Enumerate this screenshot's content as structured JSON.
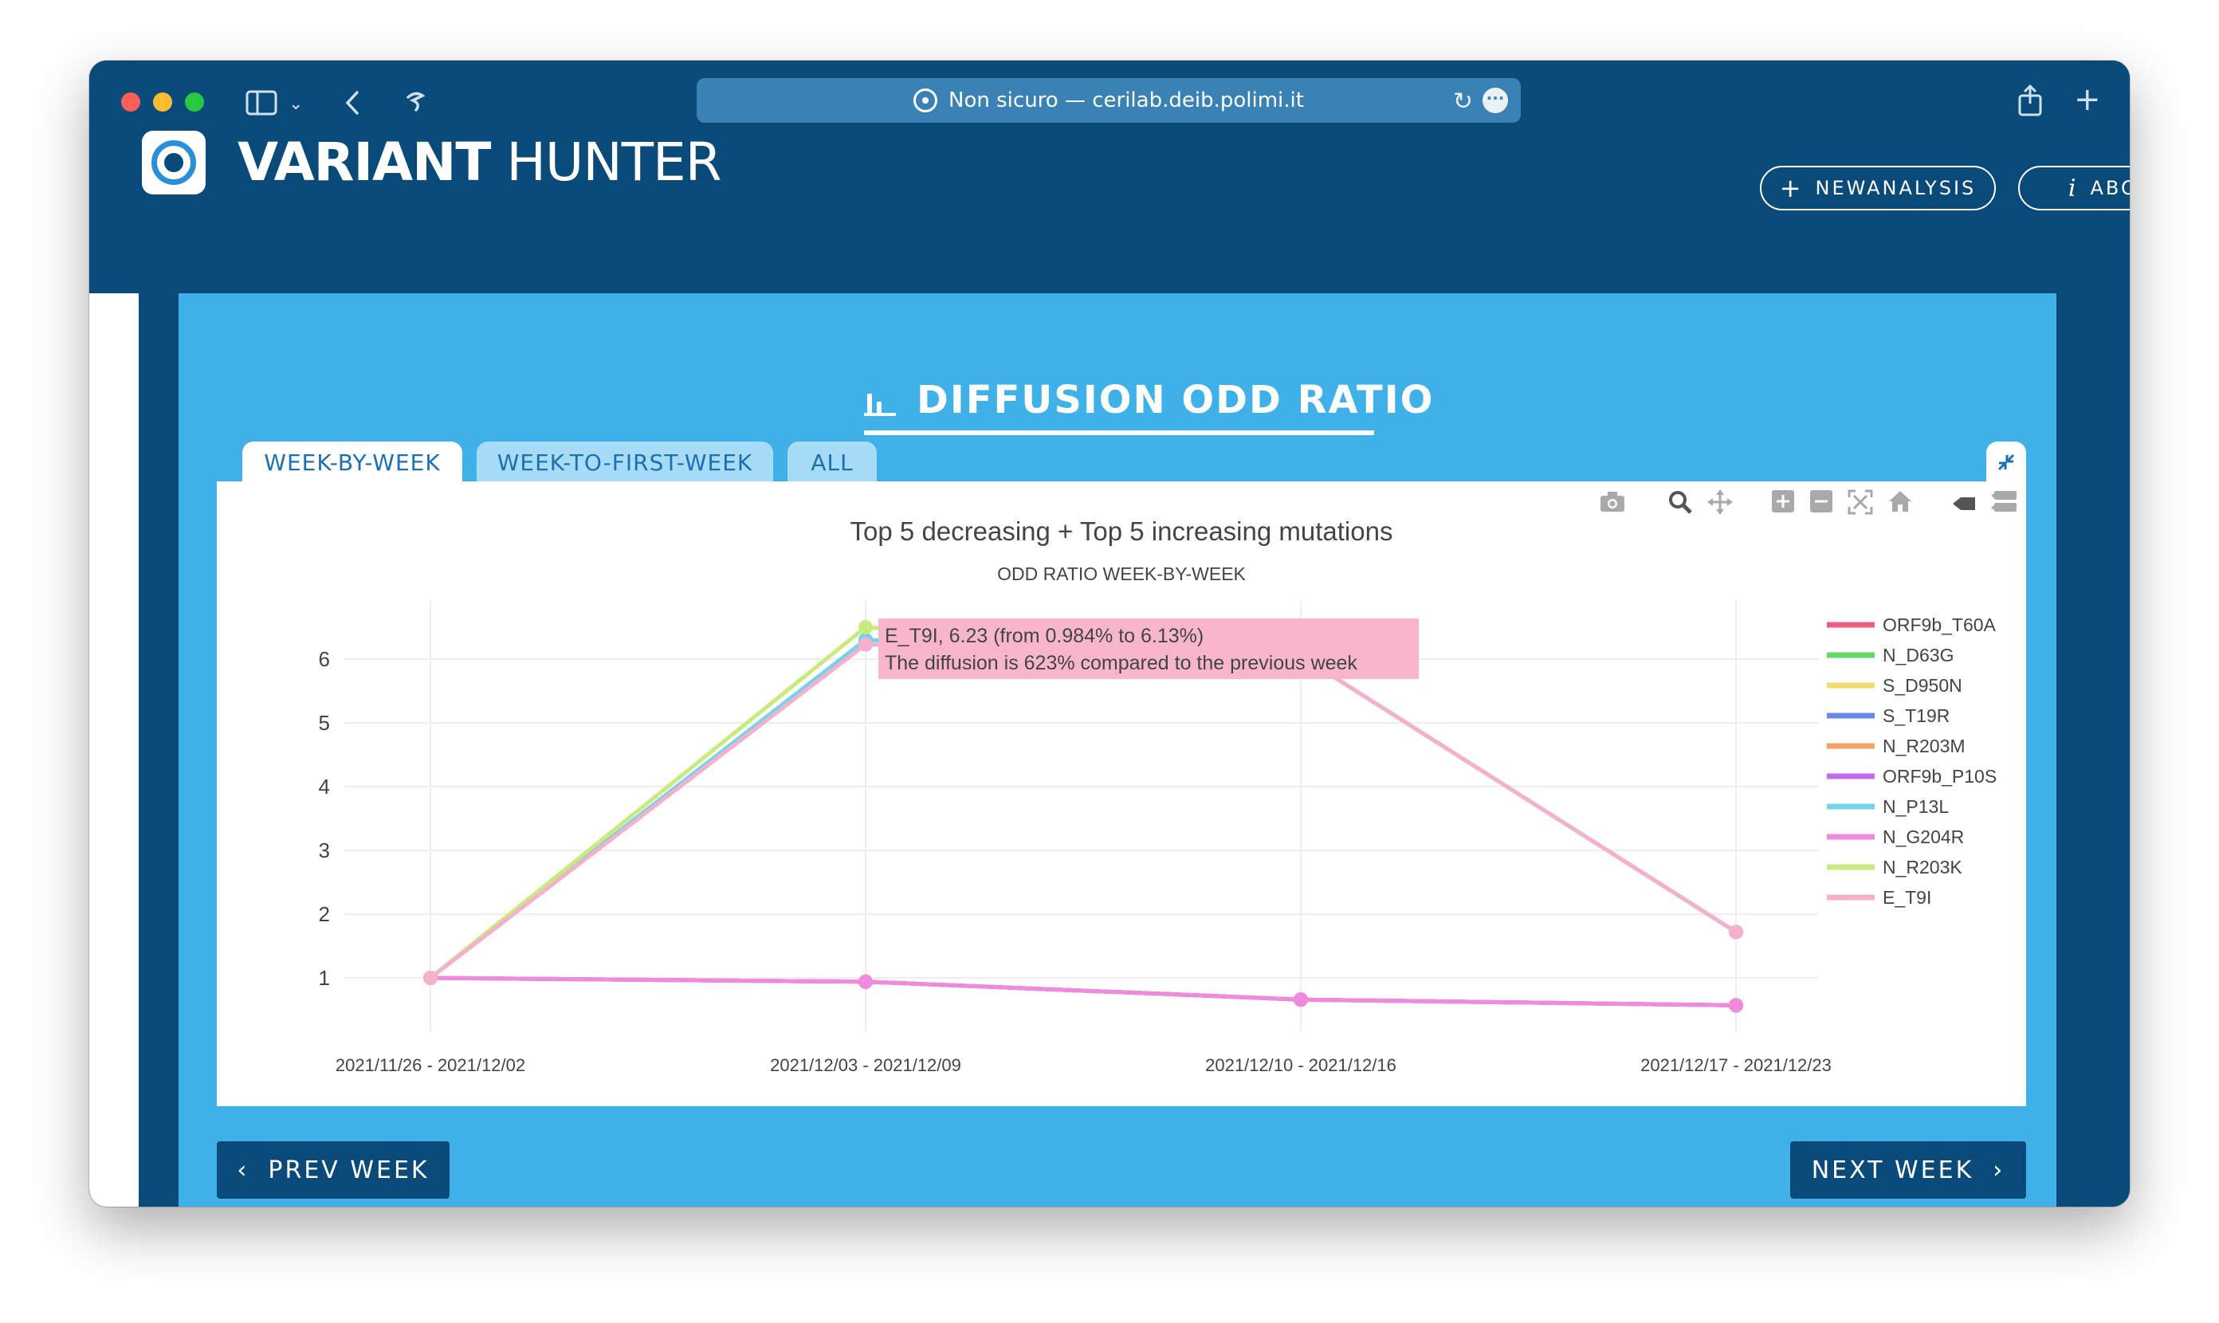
{
  "browser": {
    "url_text": "Non sicuro — cerilab.deib.polimi.it",
    "reload_icon": "reload-icon",
    "more_icon": "ellipsis-icon"
  },
  "app": {
    "brand_bold": "VARIANT",
    "brand_light": "HUNTER",
    "new_analysis_label": "NEWANALYSIS",
    "about_label": "ABOUT"
  },
  "section": {
    "title": "DIFFUSION ODD RATIO"
  },
  "tabs": [
    {
      "label": "WEEK-BY-WEEK",
      "active": true
    },
    {
      "label": "WEEK-TO-FIRST-WEEK",
      "active": false
    },
    {
      "label": "ALL",
      "active": false
    }
  ],
  "nav": {
    "prev_label": "PREV WEEK",
    "next_label": "NEXT WEEK"
  },
  "colors": {
    "header_bg": "#0a4a78",
    "panel_bg": "#3fb1e8",
    "tooltip_bg": "#f7b6cc"
  },
  "chart_data": {
    "type": "line",
    "title": "Top 5 decreasing + Top 5 increasing mutations",
    "subtitle": "ODD RATIO WEEK-BY-WEEK",
    "categories": [
      "2021/11/26 - 2021/12/02",
      "2021/12/03 - 2021/12/09",
      "2021/12/10 - 2021/12/16",
      "2021/12/17 - 2021/12/23"
    ],
    "yticks": [
      1,
      2,
      3,
      4,
      5,
      6
    ],
    "ylim": [
      0,
      7
    ],
    "grid": true,
    "legend_position": "right",
    "series": [
      {
        "name": "ORF9b_T60A",
        "color": "#ef5d7e",
        "values": [
          1,
          0.94,
          0.66,
          0.57
        ]
      },
      {
        "name": "N_D63G",
        "color": "#62d86c",
        "values": [
          1,
          0.94,
          0.66,
          0.57
        ]
      },
      {
        "name": "S_D950N",
        "color": "#f2dc6e",
        "values": [
          1,
          0.94,
          0.66,
          0.57
        ]
      },
      {
        "name": "S_T19R",
        "color": "#6c87e8",
        "values": [
          1,
          6.3,
          6.05,
          1.72
        ]
      },
      {
        "name": "N_R203M",
        "color": "#f4a261",
        "values": [
          1,
          0.94,
          0.66,
          0.57
        ]
      },
      {
        "name": "ORF9b_P10S",
        "color": "#c56be8",
        "values": [
          1,
          0.94,
          0.66,
          0.57
        ]
      },
      {
        "name": "N_P13L",
        "color": "#73d3ea",
        "values": [
          1,
          6.3,
          6.05,
          1.72
        ]
      },
      {
        "name": "N_G204R",
        "color": "#f08adf",
        "values": [
          1,
          0.94,
          0.66,
          0.57
        ]
      },
      {
        "name": "N_R203K",
        "color": "#c9ea7c",
        "values": [
          1,
          6.5,
          6.05,
          1.72
        ]
      },
      {
        "name": "E_T9I",
        "color": "#f5b1cb",
        "values": [
          1,
          6.23,
          6.05,
          1.72
        ]
      }
    ],
    "tooltip": {
      "line1": "E_T9I, 6.23 (from 0.984% to 6.13%)",
      "line2": "The diffusion is 623% compared to the previous week"
    }
  }
}
